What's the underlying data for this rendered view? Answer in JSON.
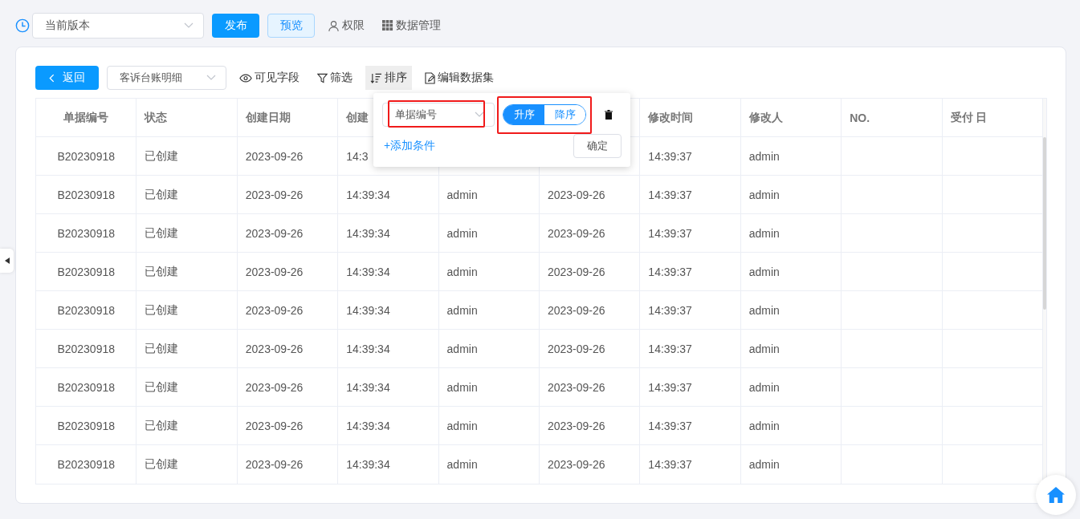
{
  "top_bar": {
    "version_select": {
      "value": "当前版本"
    },
    "buttons": [
      {
        "label": "发布",
        "kind": "primary"
      },
      {
        "label": "预览",
        "kind": "light"
      },
      {
        "label": "权限",
        "kind": "user"
      },
      {
        "label": "数据管理",
        "kind": "grid"
      }
    ]
  },
  "toolbar": {
    "back": "返回",
    "dataset_select": {
      "value": "客诉台账明细"
    },
    "tools": [
      {
        "label": "可见字段",
        "kind": "eye",
        "selected": false
      },
      {
        "label": "筛选",
        "kind": "filter",
        "selected": false
      },
      {
        "label": "排序",
        "kind": "sort",
        "selected": true
      },
      {
        "label": "编辑数据集",
        "kind": "edit",
        "selected": false
      }
    ]
  },
  "table": {
    "columns": [
      "单据编号",
      "状态",
      "创建日期",
      "创建",
      null,
      null,
      "修改时间",
      "修改人",
      "NO.",
      "受付 日"
    ],
    "rows": [
      [
        "B20230918",
        "已创建",
        "2023-09-26",
        "14:3",
        null,
        null,
        "14:39:37",
        "admin",
        null,
        null
      ],
      [
        "B20230918",
        "已创建",
        "2023-09-26",
        "14:39:34",
        "admin",
        "2023-09-26",
        "14:39:37",
        "admin",
        null,
        null
      ],
      [
        "B20230918",
        "已创建",
        "2023-09-26",
        "14:39:34",
        "admin",
        "2023-09-26",
        "14:39:37",
        "admin",
        null,
        null
      ],
      [
        "B20230918",
        "已创建",
        "2023-09-26",
        "14:39:34",
        "admin",
        "2023-09-26",
        "14:39:37",
        "admin",
        null,
        null
      ],
      [
        "B20230918",
        "已创建",
        "2023-09-26",
        "14:39:34",
        "admin",
        "2023-09-26",
        "14:39:37",
        "admin",
        null,
        null
      ],
      [
        "B20230918",
        "已创建",
        "2023-09-26",
        "14:39:34",
        "admin",
        "2023-09-26",
        "14:39:37",
        "admin",
        null,
        null
      ],
      [
        "B20230918",
        "已创建",
        "2023-09-26",
        "14:39:34",
        "admin",
        "2023-09-26",
        "14:39:37",
        "admin",
        null,
        null
      ],
      [
        "B20230918",
        "已创建",
        "2023-09-26",
        "14:39:34",
        "admin",
        "2023-09-26",
        "14:39:37",
        "admin",
        null,
        null
      ],
      [
        "B20230918",
        "已创建",
        "2023-09-26",
        "14:39:34",
        "admin",
        "2023-09-26",
        "14:39:37",
        "admin",
        null,
        null
      ]
    ]
  },
  "sort_popup": {
    "field_select": {
      "value": "单据编号",
      "highlighted": true
    },
    "order_toggle": {
      "highlighted": true,
      "options": [
        {
          "label": "升序",
          "selected": true
        },
        {
          "label": "降序",
          "selected": false
        }
      ]
    },
    "add_condition": "+添加条件",
    "confirm": "确定"
  }
}
